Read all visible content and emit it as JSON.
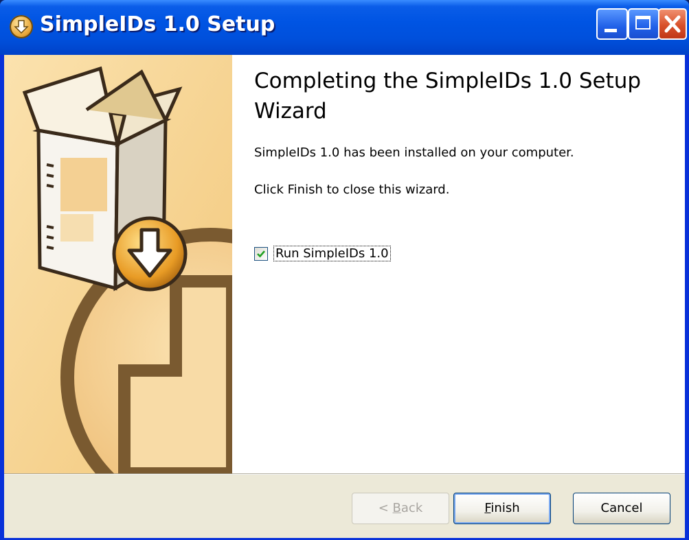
{
  "window": {
    "title": "SimpleIDs 1.0 Setup",
    "icon": "installer-icon",
    "controls": [
      "minimize",
      "maximize",
      "close"
    ]
  },
  "content": {
    "heading": "Completing the SimpleIDs 1.0 Setup Wizard",
    "installed_message": "SimpleIDs 1.0 has been installed on your computer.",
    "finish_message": "Click Finish to close this wizard.",
    "run_checkbox": {
      "label": "Run SimpleIDs 1.0",
      "checked": true
    }
  },
  "buttons": {
    "back": {
      "prefix": "< ",
      "mnemonic": "B",
      "rest": "ack",
      "enabled": false
    },
    "finish": {
      "mnemonic": "F",
      "rest": "inish"
    },
    "cancel": {
      "label": "Cancel"
    }
  },
  "colors": {
    "titlebar": "#0054E3",
    "sidebar": "#F7D79A",
    "footer": "#ECE9D8",
    "checkmark": "#21A121"
  }
}
